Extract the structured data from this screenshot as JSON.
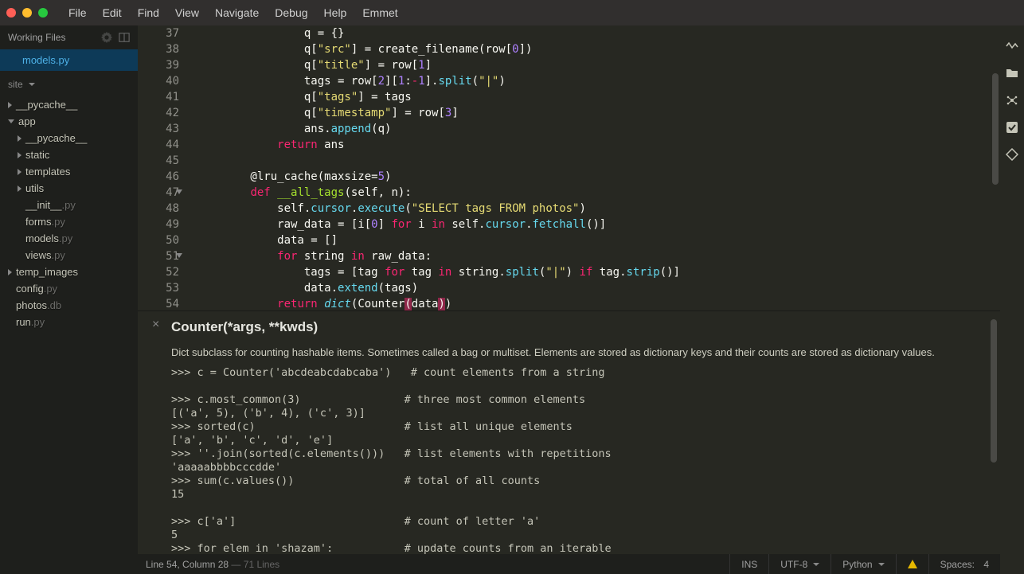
{
  "menubar": [
    "File",
    "Edit",
    "Find",
    "View",
    "Navigate",
    "Debug",
    "Help",
    "Emmet"
  ],
  "working_files": {
    "header": "Working Files",
    "items": [
      "models.py"
    ]
  },
  "project": {
    "root": "site",
    "tree": [
      {
        "t": "d",
        "n": "__pycache__",
        "lvl": 0
      },
      {
        "t": "do",
        "n": "app",
        "lvl": 0
      },
      {
        "t": "d",
        "n": "__pycache__",
        "lvl": 1
      },
      {
        "t": "d",
        "n": "static",
        "lvl": 1
      },
      {
        "t": "d",
        "n": "templates",
        "lvl": 1
      },
      {
        "t": "d",
        "n": "utils",
        "lvl": 1
      },
      {
        "t": "f",
        "n": "__init__",
        "e": ".py",
        "lvl": 1
      },
      {
        "t": "f",
        "n": "forms",
        "e": ".py",
        "lvl": 1
      },
      {
        "t": "f",
        "n": "models",
        "e": ".py",
        "lvl": 1
      },
      {
        "t": "f",
        "n": "views",
        "e": ".py",
        "lvl": 1
      },
      {
        "t": "d",
        "n": "temp_images",
        "lvl": 0
      },
      {
        "t": "f",
        "n": "config",
        "e": ".py",
        "lvl": 0
      },
      {
        "t": "f",
        "n": "photos",
        "e": ".db",
        "lvl": 0
      },
      {
        "t": "f",
        "n": "run",
        "e": ".py",
        "lvl": 0
      }
    ]
  },
  "gutter": {
    "start": 37,
    "end": 54,
    "folds": [
      47,
      51
    ]
  },
  "code_lines": [
    "                q = {}",
    "                q[<s>\"src\"</s>] = create_filename(row[<n>0</n>])",
    "                q[<s>\"title\"</s>] = row[<n>1</n>]",
    "                tags = row[<n>2</n>][<n>1</n>:<o>-</o><n>1</n>].<f>split</f>(<s>\"|\"</s>)",
    "                q[<s>\"tags\"</s>] = tags",
    "                q[<s>\"timestamp\"</s>] = row[<n>3</n>]",
    "                ans.<f>append</f>(q)",
    "            <k>return</k> ans",
    "",
    "        @lru_cache(maxsize=<n>5</n>)",
    "        <k>def</k> <d>__all_tags</d>(self, n):",
    "            self.<f>cursor</f>.<f>execute</f>(<s>\"SELECT tags FROM photos\"</s>)",
    "            raw_data = [i[<n>0</n>] <k>for</k> i <k>in</k> self.<f>cursor</f>.<f>fetchall</f>()]",
    "            data = []",
    "            <k>for</k> string <k>in</k> raw_data:",
    "                tags = [tag <k>for</k> tag <k>in</k> string.<f>split</f>(<s>\"|\"</s>) <k>if</k> tag.<f>strip</f>()]",
    "                data.<f>extend</f>(tags)",
    "            <k>return</k> <b>dict</b>(Counter<h>(</h>data<h>)</h>)"
  ],
  "doc": {
    "title": "Counter(*args, **kwds)",
    "desc": "Dict subclass for counting hashable items. Sometimes called a bag or multiset. Elements are stored as dictionary keys and their counts are stored as dictionary values.",
    "code": ">>> c = Counter('abcdeabcdabcaba')   # count elements from a string\n\n>>> c.most_common(3)                # three most common elements\n[('a', 5), ('b', 4), ('c', 3)]\n>>> sorted(c)                       # list all unique elements\n['a', 'b', 'c', 'd', 'e']\n>>> ''.join(sorted(c.elements()))   # list elements with repetitions\n'aaaaabbbbcccdde'\n>>> sum(c.values())                 # total of all counts\n15\n\n>>> c['a']                          # count of letter 'a'\n5\n>>> for elem in 'shazam':           # update counts from an iterable"
  },
  "statusbar": {
    "pos": "Line 54, Column 28",
    "lines": "71 Lines",
    "ins": "INS",
    "enc": "UTF-8",
    "lang": "Python",
    "spaces": "Spaces:",
    "spaces_n": "4"
  },
  "right_icons": [
    "history-icon",
    "folder-icon",
    "extensions-icon",
    "check-icon",
    "diamond-icon"
  ]
}
